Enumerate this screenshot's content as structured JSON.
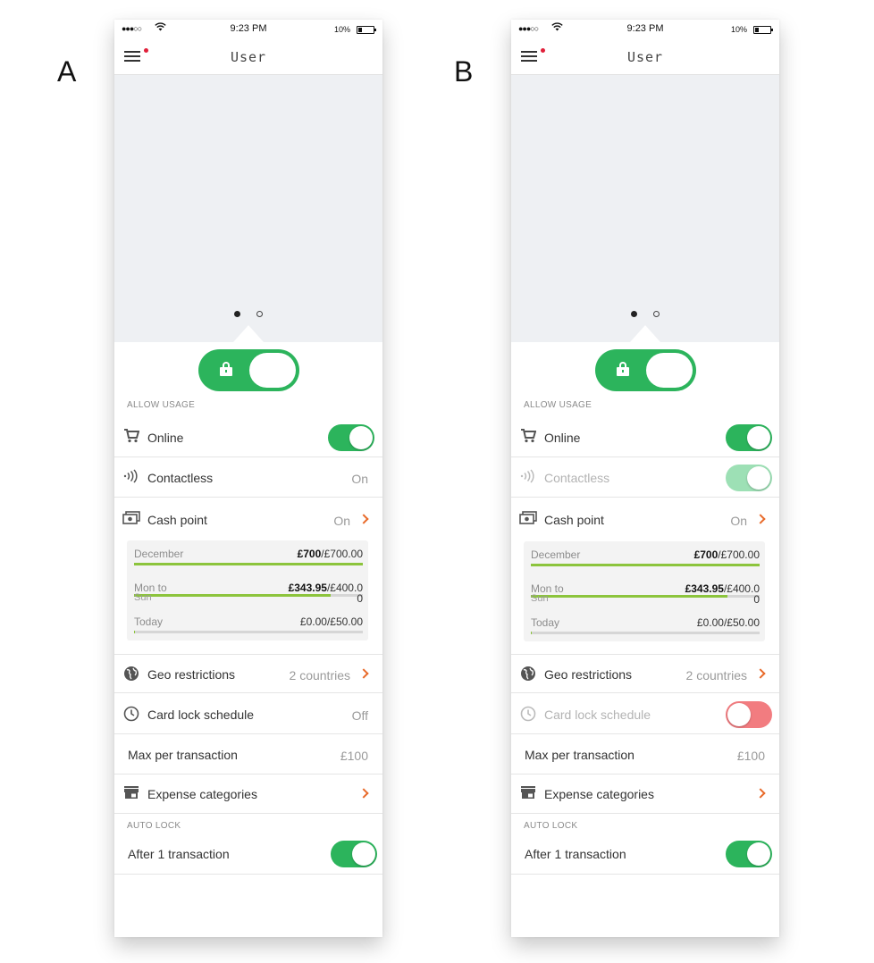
{
  "phones": [
    {
      "label": "A",
      "status": {
        "signal": "●●●○○",
        "time": "9:23 PM",
        "battery": "10%"
      },
      "nav_title": "User",
      "section_allow": "ALLOW USAGE",
      "rows": {
        "online": {
          "label": "Online"
        },
        "contactless": {
          "label": "Contactless",
          "value": "On"
        },
        "cashpoint": {
          "label": "Cash point",
          "value": "On"
        },
        "geo": {
          "label": "Geo restrictions",
          "value": "2 countries"
        },
        "schedule": {
          "label": "Card lock schedule",
          "value": "Off"
        },
        "max": {
          "label": "Max per transaction",
          "value": "£100"
        },
        "expense": {
          "label": "Expense categories"
        }
      },
      "limits": {
        "december": {
          "name": "December",
          "spent": "£700",
          "limit": "/£700.00",
          "fraction": 1.0
        },
        "week": {
          "name": "Mon to",
          "name2": "Sun",
          "spent": "£343.95",
          "limit": "/£400.0",
          "limit2": "0",
          "fraction": 0.86
        },
        "today": {
          "name": "Today",
          "amount": "£0.00/£50.00",
          "fraction": 0.0
        }
      },
      "section_auto": "AUTO LOCK",
      "autolock": {
        "label": "After 1 transaction"
      }
    },
    {
      "label": "B",
      "status": {
        "signal": "●●●○○",
        "time": "9:23 PM",
        "battery": "10%"
      },
      "nav_title": "User",
      "section_allow": "ALLOW USAGE",
      "rows": {
        "online": {
          "label": "Online"
        },
        "contactless": {
          "label": "Contactless"
        },
        "cashpoint": {
          "label": "Cash point",
          "value": "On"
        },
        "geo": {
          "label": "Geo restrictions",
          "value": "2 countries"
        },
        "schedule": {
          "label": "Card lock schedule"
        },
        "max": {
          "label": "Max per transaction",
          "value": "£100"
        },
        "expense": {
          "label": "Expense categories"
        }
      },
      "limits": {
        "december": {
          "name": "December",
          "spent": "£700",
          "limit": "/£700.00",
          "fraction": 1.0
        },
        "week": {
          "name": "Mon to",
          "name2": "Sun",
          "spent": "£343.95",
          "limit": "/£400.0",
          "limit2": "0",
          "fraction": 0.86
        },
        "today": {
          "name": "Today",
          "amount": "£0.00/£50.00",
          "fraction": 0.0
        }
      },
      "section_auto": "AUTO LOCK",
      "autolock": {
        "label": "After 1 transaction"
      }
    }
  ],
  "colors": {
    "green": "#2cb45c",
    "green_faded": "#9de0b5",
    "red_switch": "#f27c80",
    "accent_orange": "#e86a2a",
    "progress": "#8cc43c"
  }
}
